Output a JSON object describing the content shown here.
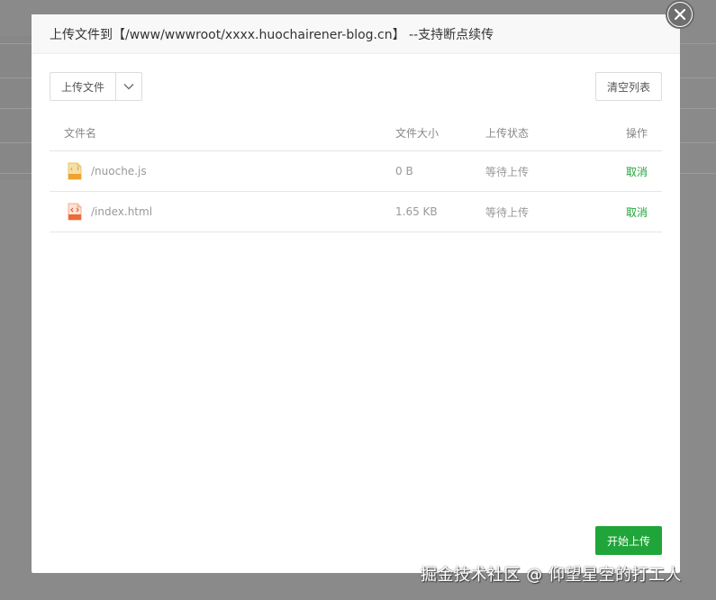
{
  "dialog": {
    "title": "上传文件到【/www/wwwroot/xxxx.huochairener-blog.cn】 --支持断点续传"
  },
  "toolbar": {
    "upload_label": "上传文件",
    "clear_label": "清空列表"
  },
  "table": {
    "headers": {
      "name": "文件名",
      "size": "文件大小",
      "status": "上传状态",
      "op": "操作"
    },
    "rows": [
      {
        "name": "/nuoche.js",
        "size": "0 B",
        "status": "等待上传",
        "op": "取消",
        "icon": "js-file-icon"
      },
      {
        "name": "/index.html",
        "size": "1.65 KB",
        "status": "等待上传",
        "op": "取消",
        "icon": "html-file-icon"
      }
    ]
  },
  "footer": {
    "start_label": "开始上传"
  },
  "watermark": "掘金技术社区 @ 仰望星空的打工人",
  "colors": {
    "accent": "#20a53a",
    "overlay": "#8a8a8a"
  }
}
